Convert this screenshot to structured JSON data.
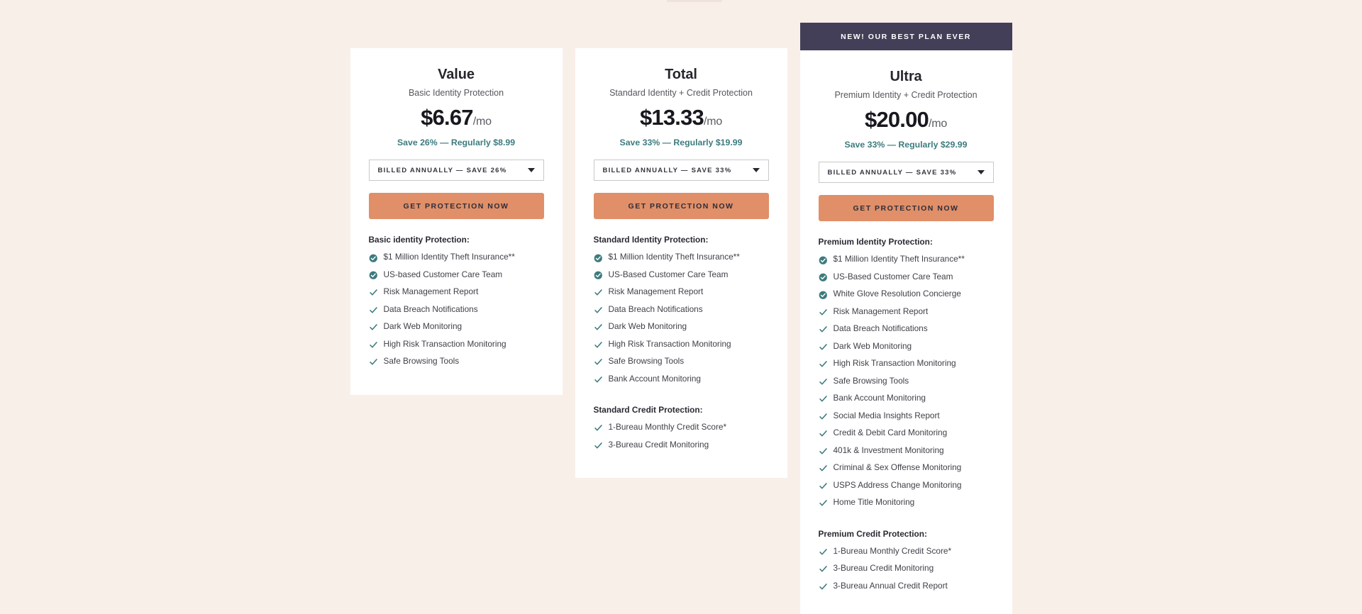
{
  "background_color": "#f9efe9",
  "accent_colors": {
    "cta_button": "#e08f68",
    "badge": "#433f58",
    "check_teal": "#3d7b7e",
    "savings_text": "#3d7b7e"
  },
  "plans": [
    {
      "id": "value",
      "badge": null,
      "name": "Value",
      "tagline": "Basic Identity Protection",
      "price": "$6.67",
      "period": "/mo",
      "savings": "Save 26% — Regularly $8.99",
      "billing_option": "BILLED ANNUALLY — SAVE 26%",
      "cta_label": "GET PROTECTION NOW",
      "sections": [
        {
          "heading": "Basic identity Protection:",
          "items": [
            {
              "label": "$1 Million Identity Theft Insurance**",
              "icon": "check-circle-filled-icon"
            },
            {
              "label": "US-based Customer Care Team",
              "icon": "check-circle-filled-icon"
            },
            {
              "label": "Risk Management Report",
              "icon": "check-icon"
            },
            {
              "label": "Data Breach Notifications",
              "icon": "check-icon"
            },
            {
              "label": "Dark Web Monitoring",
              "icon": "check-icon"
            },
            {
              "label": "High Risk Transaction Monitoring",
              "icon": "check-icon"
            },
            {
              "label": "Safe Browsing Tools",
              "icon": "check-icon"
            }
          ]
        }
      ]
    },
    {
      "id": "total",
      "badge": null,
      "name": "Total",
      "tagline": "Standard Identity + Credit Protection",
      "price": "$13.33",
      "period": "/mo",
      "savings": "Save 33% — Regularly $19.99",
      "billing_option": "BILLED ANNUALLY — SAVE 33%",
      "cta_label": "GET PROTECTION NOW",
      "sections": [
        {
          "heading": "Standard Identity Protection:",
          "items": [
            {
              "label": "$1 Million Identity Theft Insurance**",
              "icon": "check-circle-filled-icon"
            },
            {
              "label": "US-Based Customer Care Team",
              "icon": "check-circle-filled-icon"
            },
            {
              "label": "Risk Management Report",
              "icon": "check-icon"
            },
            {
              "label": "Data Breach Notifications",
              "icon": "check-icon"
            },
            {
              "label": "Dark Web Monitoring",
              "icon": "check-icon"
            },
            {
              "label": "High Risk Transaction Monitoring",
              "icon": "check-icon"
            },
            {
              "label": "Safe Browsing Tools",
              "icon": "check-icon"
            },
            {
              "label": "Bank Account Monitoring",
              "icon": "check-icon"
            }
          ]
        },
        {
          "heading": "Standard Credit Protection:",
          "items": [
            {
              "label": "1-Bureau Monthly Credit Score*",
              "icon": "check-icon"
            },
            {
              "label": "3-Bureau Credit Monitoring",
              "icon": "check-icon"
            }
          ]
        }
      ]
    },
    {
      "id": "ultra",
      "badge": "NEW! OUR BEST PLAN EVER",
      "name": "Ultra",
      "tagline": "Premium Identity + Credit Protection",
      "price": "$20.00",
      "period": "/mo",
      "savings": "Save 33% — Regularly $29.99",
      "billing_option": "BILLED ANNUALLY — SAVE 33%",
      "cta_label": "GET PROTECTION NOW",
      "sections": [
        {
          "heading": "Premium Identity Protection:",
          "items": [
            {
              "label": "$1 Million Identity Theft Insurance**",
              "icon": "check-circle-filled-icon"
            },
            {
              "label": "US-Based Customer Care Team",
              "icon": "check-circle-filled-icon"
            },
            {
              "label": "White Glove Resolution Concierge",
              "icon": "check-circle-filled-icon"
            },
            {
              "label": "Risk Management Report",
              "icon": "check-icon"
            },
            {
              "label": "Data Breach Notifications",
              "icon": "check-icon"
            },
            {
              "label": "Dark Web Monitoring",
              "icon": "check-icon"
            },
            {
              "label": "High Risk Transaction Monitoring",
              "icon": "check-icon"
            },
            {
              "label": "Safe Browsing Tools",
              "icon": "check-icon"
            },
            {
              "label": "Bank Account Monitoring",
              "icon": "check-icon"
            },
            {
              "label": "Social Media Insights Report",
              "icon": "check-icon"
            },
            {
              "label": "Credit & Debit Card Monitoring",
              "icon": "check-icon"
            },
            {
              "label": "401k & Investment Monitoring",
              "icon": "check-icon"
            },
            {
              "label": "Criminal & Sex Offense Monitoring",
              "icon": "check-icon"
            },
            {
              "label": "USPS Address Change Monitoring",
              "icon": "check-icon"
            },
            {
              "label": "Home Title Monitoring",
              "icon": "check-icon"
            }
          ]
        },
        {
          "heading": "Premium Credit Protection:",
          "items": [
            {
              "label": "1-Bureau Monthly Credit Score*",
              "icon": "check-icon"
            },
            {
              "label": "3-Bureau Credit Monitoring",
              "icon": "check-icon"
            },
            {
              "label": "3-Bureau Annual Credit Report",
              "icon": "check-icon"
            }
          ]
        }
      ]
    }
  ]
}
